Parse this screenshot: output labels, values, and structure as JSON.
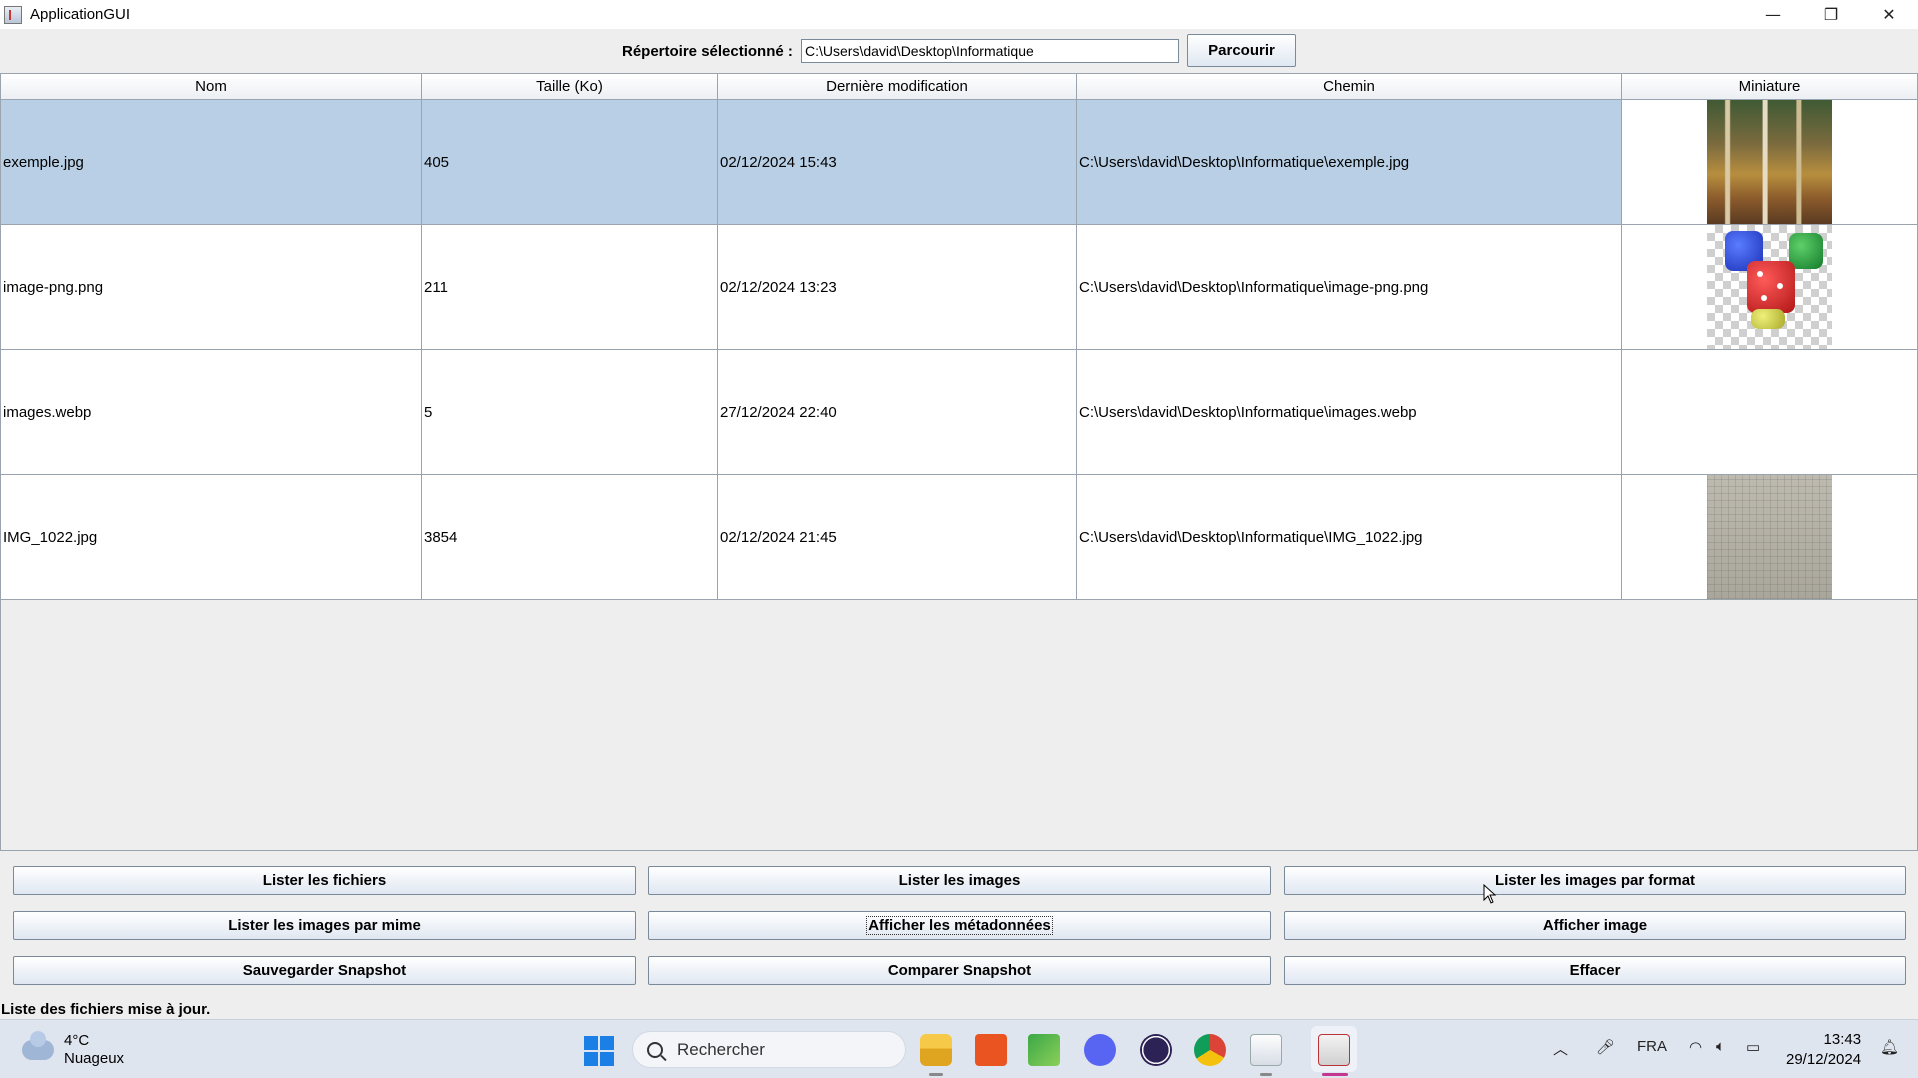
{
  "window": {
    "title": "ApplicationGUI",
    "minimize": "—",
    "maximize": "❐",
    "close": "✕"
  },
  "directory": {
    "label": "Répertoire sélectionné :",
    "value": "C:\\Users\\david\\Desktop\\Informatique",
    "browse_label": "Parcourir"
  },
  "table": {
    "columns": [
      "Nom",
      "Taille (Ko)",
      "Dernière modification",
      "Chemin",
      "Miniature"
    ],
    "rows": [
      {
        "name": "exemple.jpg",
        "size": "405",
        "modified": "02/12/2024 15:43",
        "path": "C:\\Users\\david\\Desktop\\Informatique\\exemple.jpg",
        "thumb": "forest",
        "selected": true
      },
      {
        "name": "image-png.png",
        "size": "211",
        "modified": "02/12/2024 13:23",
        "path": "C:\\Users\\david\\Desktop\\Informatique\\image-png.png",
        "thumb": "dice",
        "selected": false
      },
      {
        "name": "images.webp",
        "size": "5",
        "modified": "27/12/2024 22:40",
        "path": "C:\\Users\\david\\Desktop\\Informatique\\images.webp",
        "thumb": "none",
        "selected": false
      },
      {
        "name": "IMG_1022.jpg",
        "size": "3854",
        "modified": "02/12/2024 21:45",
        "path": "C:\\Users\\david\\Desktop\\Informatique\\IMG_1022.jpg",
        "thumb": "paper",
        "selected": false
      }
    ]
  },
  "buttons": {
    "list_files": "Lister les fichiers",
    "list_images": "Lister les images",
    "list_by_format": "Lister les images par format",
    "list_by_mime": "Lister les images par mime",
    "show_metadata": "Afficher les métadonnées",
    "show_image": "Afficher image",
    "save_snapshot": "Sauvegarder Snapshot",
    "compare_snapshot": "Comparer Snapshot",
    "clear": "Effacer"
  },
  "status": "Liste des fichiers mise à jour.",
  "taskbar": {
    "weather_temp": "4°C",
    "weather_desc": "Nuageux",
    "search_placeholder": "Rechercher",
    "language": "FRA",
    "time": "13:43",
    "date": "29/12/2024",
    "apps": [
      "file-explorer-icon",
      "ubuntu-icon",
      "image-viewer-icon",
      "discord-icon",
      "eclipse-icon",
      "chrome-icon",
      "snipping-tool-icon",
      "java-icon"
    ]
  },
  "colors": {
    "selection": "#b8cfe5",
    "accent": "#1b7fe6"
  }
}
